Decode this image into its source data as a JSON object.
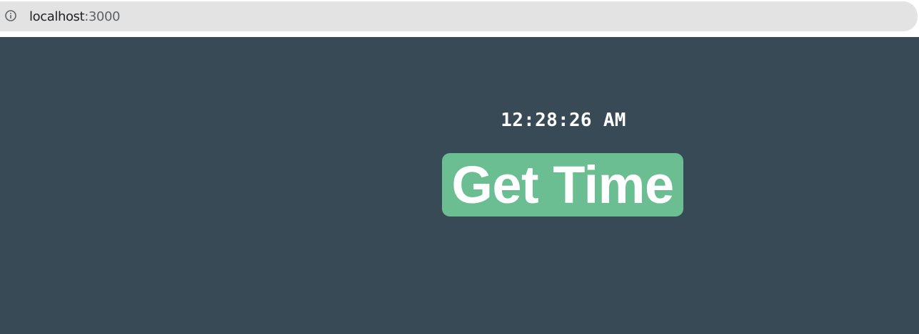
{
  "browser": {
    "url_host": "localhost",
    "url_port": ":3000",
    "info_icon": "info-icon"
  },
  "main": {
    "time": "12:28:26 AM",
    "button_label": "Get Time"
  },
  "colors": {
    "page_background": "#394a57",
    "button_background": "#6bbe92",
    "text": "#ffffff",
    "address_bar": "#e3e3e3"
  }
}
